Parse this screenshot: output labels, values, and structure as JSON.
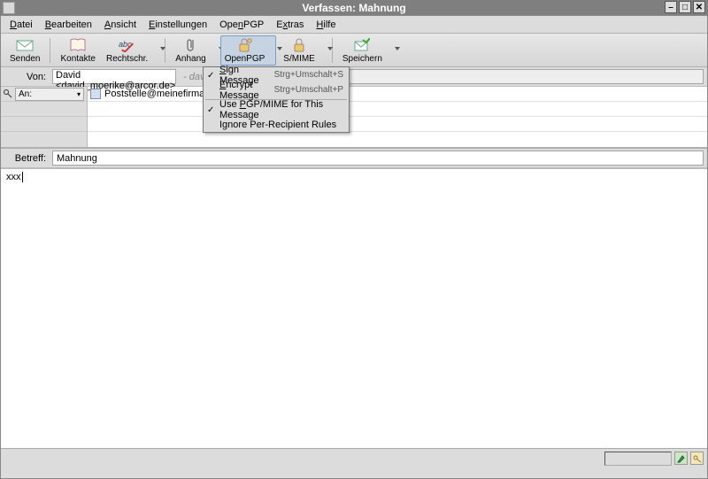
{
  "window": {
    "title": "Verfassen: Mahnung"
  },
  "menubar": [
    {
      "label": "Datei",
      "accel": "D"
    },
    {
      "label": "Bearbeiten",
      "accel": "B"
    },
    {
      "label": "Ansicht",
      "accel": "A"
    },
    {
      "label": "Einstellungen",
      "accel": "E"
    },
    {
      "label": "OpenPGP",
      "accel": "n"
    },
    {
      "label": "Extras",
      "accel": "x"
    },
    {
      "label": "Hilfe",
      "accel": "H"
    }
  ],
  "toolbar": {
    "send": "Senden",
    "contacts": "Kontakte",
    "spell": "Rechtschr.",
    "attach": "Anhang",
    "openpgp": "OpenPGP",
    "smime": "S/MIME",
    "save": "Speichern"
  },
  "from": {
    "label": "Von:",
    "value": "David <david_moerike@arcor.de>",
    "signature": "- david_moe"
  },
  "recipients": {
    "type_label": "An:",
    "to_value": "Poststelle@meinefirma.com"
  },
  "subject": {
    "label": "Betreff:",
    "value": "Mahnung"
  },
  "body": {
    "text": "xxx"
  },
  "openpgp_menu": {
    "sign": {
      "label": "Sign Message",
      "shortcut": "Strg+Umschalt+S",
      "checked": true
    },
    "encrypt": {
      "label": "Encrypt Message",
      "shortcut": "Strg+Umschalt+P",
      "checked": false
    },
    "pgpmime": {
      "label": "Use PGP/MIME for This Message",
      "checked": true
    },
    "ignore": {
      "label": "Ignore Per-Recipient Rules",
      "checked": false
    }
  }
}
